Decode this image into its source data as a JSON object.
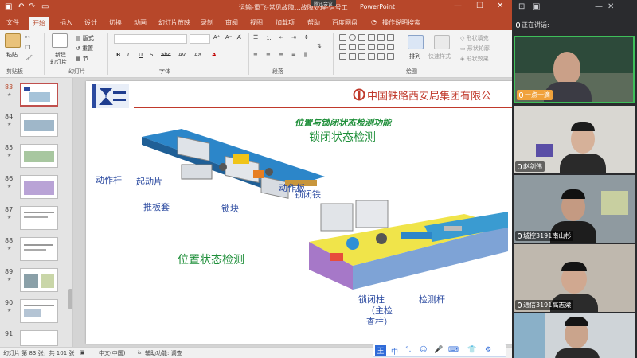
{
  "titlebar": {
    "title": "运输-重飞-常见故障…故障处理-信号工",
    "app": "PowerPoint",
    "meeting": "腾讯会议",
    "lightbulb_tip": "操作说明搜索"
  },
  "tabs": [
    "文件",
    "开始",
    "插入",
    "设计",
    "切换",
    "动画",
    "幻灯片放映",
    "录制",
    "审阅",
    "视图",
    "加载项",
    "帮助",
    "百度网盘"
  ],
  "ribbon": {
    "paste": "粘贴",
    "clipboard": "剪贴板",
    "new_slide": "新建",
    "new_slide2": "幻灯片",
    "layout": "版式",
    "reset": "重置",
    "section": "节",
    "slides_group": "幻灯片",
    "font_group": "字体",
    "paragraph_group": "段落",
    "drawing_group": "绘图",
    "arrange": "排列",
    "quick_styles": "快速样式",
    "shape_fill": "形状填充",
    "shape_outline": "形状轮廓",
    "shape_effects": "形状效果",
    "font_buttons": [
      "B",
      "I",
      "U",
      "S",
      "abc",
      "AV",
      "Aa",
      "A"
    ]
  },
  "thumbnails": [
    {
      "num": "83",
      "active": true
    },
    {
      "num": "84",
      "active": false
    },
    {
      "num": "85",
      "active": false
    },
    {
      "num": "86",
      "active": false
    },
    {
      "num": "87",
      "active": false
    },
    {
      "num": "88",
      "active": false
    },
    {
      "num": "89",
      "active": false
    },
    {
      "num": "90",
      "active": false
    },
    {
      "num": "91",
      "active": false
    }
  ],
  "slide": {
    "company": "中国铁路西安局集团有限公",
    "heading": "位置与锁闭状态检测功能",
    "lock_state": "锁闭状态检测",
    "position_state": "位置状态检测",
    "labels": {
      "action_rod": "动作杆",
      "start_piece": "起动片",
      "push_sleeve": "推板套",
      "lock_block": "锁块",
      "action_plate": "动作板",
      "lock_iron": "锁闭铁",
      "lock_column": "锁闭柱",
      "main_check": "（主检",
      "check_column": "查柱）",
      "check_rod": "检测杆"
    }
  },
  "status": {
    "slide_info": "幻灯片 第 83 张，共 101 张",
    "language": "中文(中国)",
    "accessibility": "辅助功能: 调查"
  },
  "ime": {
    "icons": [
      "中",
      "°,",
      "☺",
      "🎤",
      "⌨",
      "👕",
      "⚙"
    ]
  },
  "meeting": {
    "speaking_label": "正在讲话:",
    "participants": [
      {
        "name": "一点一滴",
        "speaking": true
      },
      {
        "name": "赵剑伟",
        "speaking": false
      },
      {
        "name": "城控3191南山杉",
        "speaking": false
      },
      {
        "name": "通信3191高志梁",
        "speaking": false
      },
      {
        "name": "",
        "speaking": false
      }
    ]
  },
  "colors": {
    "ppt_accent": "#b7472a",
    "slide_title": "#1f8f3a",
    "company_red": "#c0392b",
    "speaking_border": "#3fbf5a"
  }
}
